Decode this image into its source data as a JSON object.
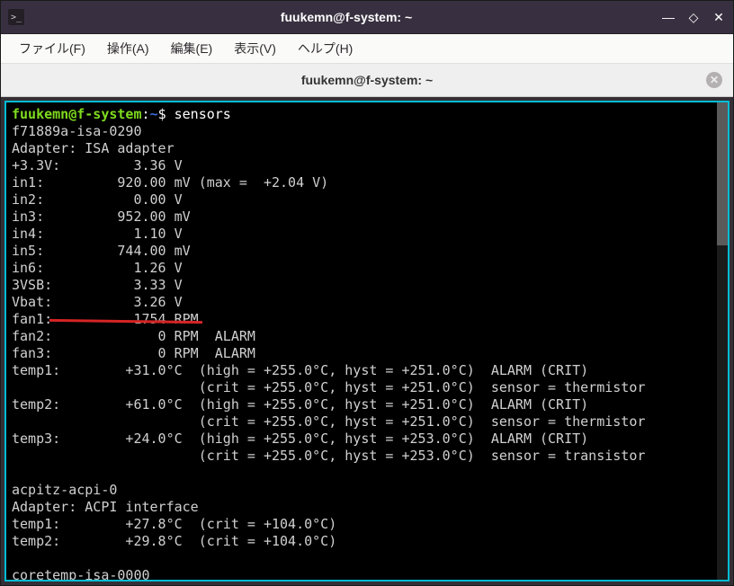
{
  "titlebar": {
    "icon_text": ">_",
    "title": "fuukemn@f-system: ~"
  },
  "menu": {
    "file": "ファイル(F)",
    "actions": "操作(A)",
    "edit": "編集(E)",
    "view": "表示(V)",
    "help": "ヘルプ(H)"
  },
  "tab": {
    "label": "fuukemn@f-system: ~",
    "close": "✕"
  },
  "prompt": {
    "user": "fuukemn@f-system",
    "colon": ":",
    "path": "~",
    "dollar": "$ ",
    "command": "sensors"
  },
  "sensors_output": {
    "adapter1_name": "f71889a-isa-0290",
    "adapter1_line": "Adapter: ISA adapter",
    "voltages": [
      {
        "label": "+3.3V:",
        "value": "         3.36 V"
      },
      {
        "label": "in1:  ",
        "value": "       920.00 mV (max =  +2.04 V)"
      },
      {
        "label": "in2:  ",
        "value": "         0.00 V"
      },
      {
        "label": "in3:  ",
        "value": "       952.00 mV"
      },
      {
        "label": "in4:  ",
        "value": "         1.10 V"
      },
      {
        "label": "in5:  ",
        "value": "       744.00 mV"
      },
      {
        "label": "in6:  ",
        "value": "         1.26 V"
      },
      {
        "label": "3VSB: ",
        "value": "         3.33 V"
      },
      {
        "label": "Vbat: ",
        "value": "         3.26 V"
      }
    ],
    "fans": [
      {
        "label": "fan1: ",
        "value": "         1754 RPM"
      },
      {
        "label": "fan2: ",
        "value": "            0 RPM  ALARM"
      },
      {
        "label": "fan3: ",
        "value": "            0 RPM  ALARM"
      }
    ],
    "temps1": [
      {
        "line": "temp1:        +31.0°C  (high = +255.0°C, hyst = +251.0°C)  ALARM (CRIT)"
      },
      {
        "line": "                       (crit = +255.0°C, hyst = +251.0°C)  sensor = thermistor"
      },
      {
        "line": "temp2:        +61.0°C  (high = +255.0°C, hyst = +251.0°C)  ALARM (CRIT)"
      },
      {
        "line": "                       (crit = +255.0°C, hyst = +251.0°C)  sensor = thermistor"
      },
      {
        "line": "temp3:        +24.0°C  (high = +255.0°C, hyst = +253.0°C)  ALARM (CRIT)"
      },
      {
        "line": "                       (crit = +255.0°C, hyst = +253.0°C)  sensor = transistor"
      }
    ],
    "blank1": "",
    "adapter2_name": "acpitz-acpi-0",
    "adapter2_line": "Adapter: ACPI interface",
    "temps2": [
      {
        "line": "temp1:        +27.8°C  (crit = +104.0°C)"
      },
      {
        "line": "temp2:        +29.8°C  (crit = +104.0°C)"
      }
    ],
    "blank2": "",
    "adapter3_name": "coretemp-isa-0000"
  }
}
